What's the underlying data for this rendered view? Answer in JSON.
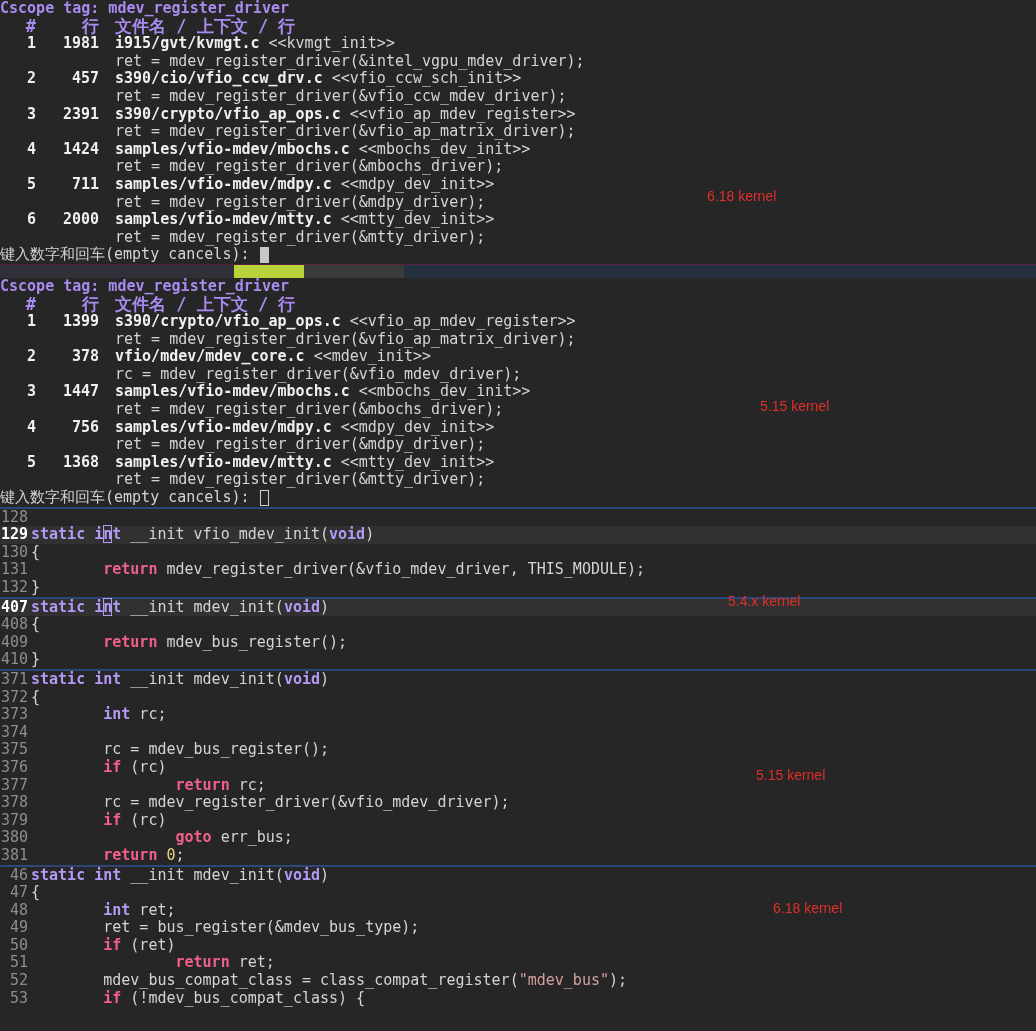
{
  "cscope_results": [
    {
      "title": "Cscope tag: mdev_register_driver",
      "columns": [
        "#",
        "行",
        "文件名 / 上下文 / 行"
      ],
      "rows": [
        {
          "index": "1",
          "line": "1981",
          "file": "i915/gvt/kvmgt.c",
          "context": "<<kvmgt_init>>",
          "code": "ret = mdev_register_driver(&intel_vgpu_mdev_driver);"
        },
        {
          "index": "2",
          "line": "457",
          "file": "s390/cio/vfio_ccw_drv.c",
          "context": "<<vfio_ccw_sch_init>>",
          "code": "ret = mdev_register_driver(&vfio_ccw_mdev_driver);"
        },
        {
          "index": "3",
          "line": "2391",
          "file": "s390/crypto/vfio_ap_ops.c",
          "context": "<<vfio_ap_mdev_register>>",
          "code": "ret = mdev_register_driver(&vfio_ap_matrix_driver);"
        },
        {
          "index": "4",
          "line": "1424",
          "file": "samples/vfio-mdev/mbochs.c",
          "context": "<<mbochs_dev_init>>",
          "code": "ret = mdev_register_driver(&mbochs_driver);"
        },
        {
          "index": "5",
          "line": "711",
          "file": "samples/vfio-mdev/mdpy.c",
          "context": "<<mdpy_dev_init>>",
          "code": "ret = mdev_register_driver(&mdpy_driver);"
        },
        {
          "index": "6",
          "line": "2000",
          "file": "samples/vfio-mdev/mtty.c",
          "context": "<<mtty_dev_init>>",
          "code": "ret = mdev_register_driver(&mtty_driver);"
        }
      ],
      "prompt": "键入数字和回车(empty cancels):",
      "cursor_filled": true,
      "note": "6.18 kernel"
    },
    {
      "title": "Cscope tag: mdev_register_driver",
      "columns": [
        "#",
        "行",
        "文件名 / 上下文 / 行"
      ],
      "rows": [
        {
          "index": "1",
          "line": "1399",
          "file": "s390/crypto/vfio_ap_ops.c",
          "context": "<<vfio_ap_mdev_register>>",
          "code": "ret = mdev_register_driver(&vfio_ap_matrix_driver);"
        },
        {
          "index": "2",
          "line": "378",
          "file": "vfio/mdev/mdev_core.c",
          "context": "<<mdev_init>>",
          "code": "rc = mdev_register_driver(&vfio_mdev_driver);"
        },
        {
          "index": "3",
          "line": "1447",
          "file": "samples/vfio-mdev/mbochs.c",
          "context": "<<mbochs_dev_init>>",
          "code": "ret = mdev_register_driver(&mbochs_driver);"
        },
        {
          "index": "4",
          "line": "756",
          "file": "samples/vfio-mdev/mdpy.c",
          "context": "<<mdpy_dev_init>>",
          "code": "ret = mdev_register_driver(&mdpy_driver);"
        },
        {
          "index": "5",
          "line": "1368",
          "file": "samples/vfio-mdev/mtty.c",
          "context": "<<mtty_dev_init>>",
          "code": "ret = mdev_register_driver(&mtty_driver);"
        }
      ],
      "prompt": "键入数字和回车(empty cancels):",
      "cursor_filled": false,
      "note": "5.15 kernel"
    }
  ],
  "code_panes": [
    {
      "lines": [
        {
          "number": "128",
          "current": false
        },
        {
          "number": "129",
          "current": true,
          "tokens": [
            {
              "kind": "type",
              "text": "static i"
            },
            {
              "kind": "cursor",
              "text": "n"
            },
            {
              "kind": "type",
              "text": "t"
            },
            {
              "kind": "plain",
              "text": " __init vfio_mdev_init("
            },
            {
              "kind": "type",
              "text": "void"
            },
            {
              "kind": "plain",
              "text": ")"
            }
          ]
        },
        {
          "number": "130",
          "current": false,
          "tokens": [
            {
              "kind": "plain",
              "text": "{"
            }
          ]
        },
        {
          "number": "131",
          "current": false,
          "tokens": [
            {
              "kind": "control",
              "text": "        return"
            },
            {
              "kind": "plain",
              "text": " mdev_register_driver(&vfio_mdev_driver, THIS_MODULE);"
            }
          ]
        },
        {
          "number": "132",
          "current": false,
          "tokens": [
            {
              "kind": "plain",
              "text": "}"
            }
          ]
        }
      ]
    },
    {
      "note": "5.4.x kernel",
      "lines": [
        {
          "number": "407",
          "current": true,
          "tokens": [
            {
              "kind": "type",
              "text": "static i"
            },
            {
              "kind": "cursor",
              "text": "n"
            },
            {
              "kind": "type",
              "text": "t"
            },
            {
              "kind": "plain",
              "text": " __init mdev_init("
            },
            {
              "kind": "type",
              "text": "void"
            },
            {
              "kind": "plain",
              "text": ")"
            }
          ]
        },
        {
          "number": "408",
          "current": false,
          "tokens": [
            {
              "kind": "plain",
              "text": "{"
            }
          ]
        },
        {
          "number": "409",
          "current": false,
          "tokens": [
            {
              "kind": "control",
              "text": "        return"
            },
            {
              "kind": "plain",
              "text": " mdev_bus_register();"
            }
          ]
        },
        {
          "number": "410",
          "current": false,
          "tokens": [
            {
              "kind": "plain",
              "text": "}"
            }
          ]
        }
      ]
    },
    {
      "note": "5.15 kernel",
      "lines": [
        {
          "number": "371",
          "current": false,
          "tokens": [
            {
              "kind": "type",
              "text": "static int"
            },
            {
              "kind": "plain",
              "text": " __init mdev_init("
            },
            {
              "kind": "type",
              "text": "void"
            },
            {
              "kind": "plain",
              "text": ")"
            }
          ]
        },
        {
          "number": "372",
          "current": false,
          "tokens": [
            {
              "kind": "plain",
              "text": "{"
            }
          ]
        },
        {
          "number": "373",
          "current": false,
          "tokens": [
            {
              "kind": "type",
              "text": "        int"
            },
            {
              "kind": "plain",
              "text": " rc;"
            }
          ]
        },
        {
          "number": "374",
          "current": false
        },
        {
          "number": "375",
          "current": false,
          "tokens": [
            {
              "kind": "plain",
              "text": "        rc = mdev_bus_register();"
            }
          ]
        },
        {
          "number": "376",
          "current": false,
          "tokens": [
            {
              "kind": "control",
              "text": "        if"
            },
            {
              "kind": "plain",
              "text": " (rc)"
            }
          ]
        },
        {
          "number": "377",
          "current": false,
          "tokens": [
            {
              "kind": "control",
              "text": "                return"
            },
            {
              "kind": "plain",
              "text": " rc;"
            }
          ]
        },
        {
          "number": "378",
          "current": false,
          "tokens": [
            {
              "kind": "plain",
              "text": "        rc = mdev_register_driver(&vfio_mdev_driver);"
            }
          ]
        },
        {
          "number": "379",
          "current": false,
          "tokens": [
            {
              "kind": "control",
              "text": "        if"
            },
            {
              "kind": "plain",
              "text": " (rc)"
            }
          ]
        },
        {
          "number": "380",
          "current": false,
          "tokens": [
            {
              "kind": "control",
              "text": "                goto"
            },
            {
              "kind": "plain",
              "text": " err_bus;"
            }
          ]
        },
        {
          "number": "381",
          "current": false,
          "tokens": [
            {
              "kind": "control",
              "text": "        return "
            },
            {
              "kind": "number",
              "text": "0"
            },
            {
              "kind": "plain",
              "text": ";"
            }
          ]
        }
      ]
    },
    {
      "note": "6.18 kernel",
      "lines": [
        {
          "number": "46",
          "current": false,
          "tokens": [
            {
              "kind": "type",
              "text": "static int"
            },
            {
              "kind": "plain",
              "text": " __init mdev_init("
            },
            {
              "kind": "type",
              "text": "void"
            },
            {
              "kind": "plain",
              "text": ")"
            }
          ]
        },
        {
          "number": "47",
          "current": false,
          "tokens": [
            {
              "kind": "plain",
              "text": "{"
            }
          ]
        },
        {
          "number": "48",
          "current": false,
          "tokens": [
            {
              "kind": "type",
              "text": "        int"
            },
            {
              "kind": "plain",
              "text": " ret;"
            }
          ]
        },
        {
          "number": "49",
          "current": false,
          "tokens": [
            {
              "kind": "plain",
              "text": "        ret = bus_register(&mdev_bus_type);"
            }
          ]
        },
        {
          "number": "50",
          "current": false,
          "tokens": [
            {
              "kind": "control",
              "text": "        if"
            },
            {
              "kind": "plain",
              "text": " (ret)"
            }
          ]
        },
        {
          "number": "51",
          "current": false,
          "tokens": [
            {
              "kind": "control",
              "text": "                return"
            },
            {
              "kind": "plain",
              "text": " ret;"
            }
          ]
        },
        {
          "number": "52",
          "current": false,
          "tokens": [
            {
              "kind": "plain",
              "text": "        mdev_bus_compat_class = class_compat_register("
            },
            {
              "kind": "string",
              "text": "\"mdev_bus\""
            },
            {
              "kind": "plain",
              "text": ");"
            }
          ]
        },
        {
          "number": "53",
          "current": false,
          "tokens": [
            {
              "kind": "control",
              "text": "        if"
            },
            {
              "kind": "plain",
              "text": " (!mdev_bus_compat_class) {"
            }
          ]
        }
      ]
    }
  ]
}
